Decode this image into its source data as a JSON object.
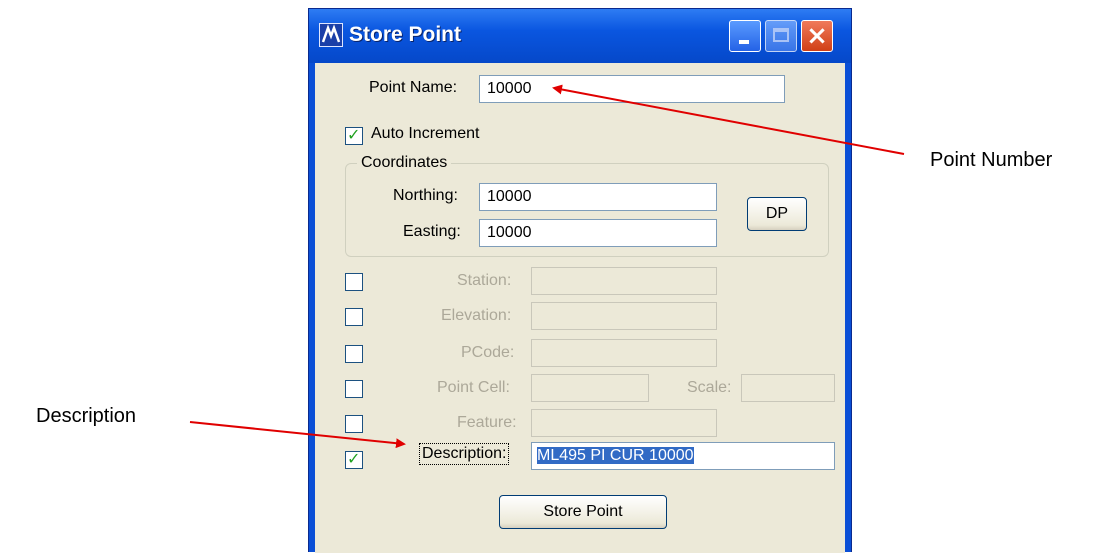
{
  "window": {
    "title": "Store Point"
  },
  "form": {
    "point_name_label": "Point Name:",
    "point_name_value": "10000",
    "auto_increment_label": "Auto Increment",
    "auto_increment_checked": true,
    "coordinates_group_label": "Coordinates",
    "northing_label": "Northing:",
    "northing_value": "10000",
    "easting_label": "Easting:",
    "easting_value": "10000",
    "dp_button_label": "DP",
    "station_label": "Station:",
    "elevation_label": "Elevation:",
    "pcode_label": "PCode:",
    "point_cell_label": "Point Cell:",
    "scale_label": "Scale:",
    "feature_label": "Feature:",
    "description_label": "Description:",
    "description_value": "ML495 PI CUR 10000",
    "description_checked": true,
    "store_point_button_label": "Store Point"
  },
  "annotations": {
    "point_number": "Point Number",
    "description": "Description",
    "arrow_color": "#e00000"
  },
  "colors": {
    "titlebar": "#0a56e0",
    "dialog_bg": "#ece9d8",
    "selection": "#316ac5",
    "check_mark": "#21a121"
  }
}
